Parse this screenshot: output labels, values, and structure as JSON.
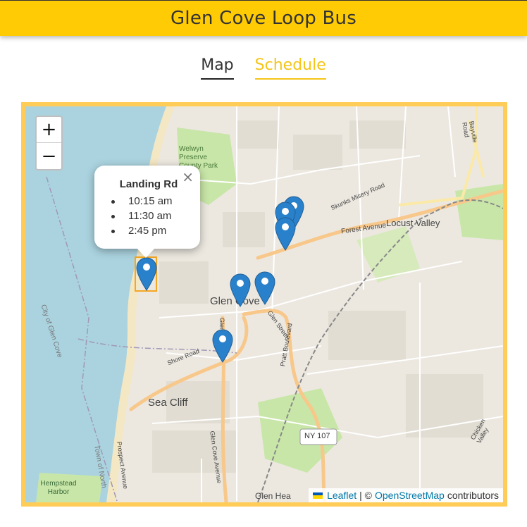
{
  "app": {
    "title": "Glen Cove Loop Bus"
  },
  "tabs": [
    {
      "label": "Map",
      "active": true
    },
    {
      "label": "Schedule",
      "active": false
    }
  ],
  "map": {
    "zoom_in": "+",
    "zoom_out": "−",
    "popup": {
      "title": "Landing Rd",
      "close": "×",
      "times": [
        "10:15 am",
        "11:30 am",
        "2:45 pm"
      ]
    },
    "labels": {
      "glen_cove": "Glen Cove",
      "sea_cliff": "Sea Cliff",
      "locust_valley": "Locust Valley",
      "welwyn": "Welwyn Preserve County Park",
      "city_of_glen_cove": "City of Glen Cove",
      "town_of_north": "Town of North",
      "hempstead_harbor": "Hempstead Harbor",
      "glen_head": "Glen Hea",
      "forest_avenue": "Forest Avenue",
      "skunks_misery": "Skunks Misery Road",
      "bayville_road": "Bayville Road",
      "shore_road": "Shore Road",
      "glen_street": "Glen Street",
      "pratt_blvd": "Pratt Boulevard",
      "prospect_ave": "Prospect Avenue",
      "glen_cove_ave": "Glen Cove Avenue",
      "glen_ave": "Glen Ave",
      "chicken_valley": "Chicken Valley",
      "ny107": "NY 107"
    },
    "attribution": {
      "leaflet": "Leaflet",
      "separator": " | © ",
      "osm": "OpenStreetMap",
      "suffix": "contributors"
    },
    "colors": {
      "frame": "#ffcd57",
      "marker": "#2a81cb",
      "water": "#aad3df",
      "park": "#c8e6a8",
      "road_major": "#fcd6a4"
    }
  }
}
